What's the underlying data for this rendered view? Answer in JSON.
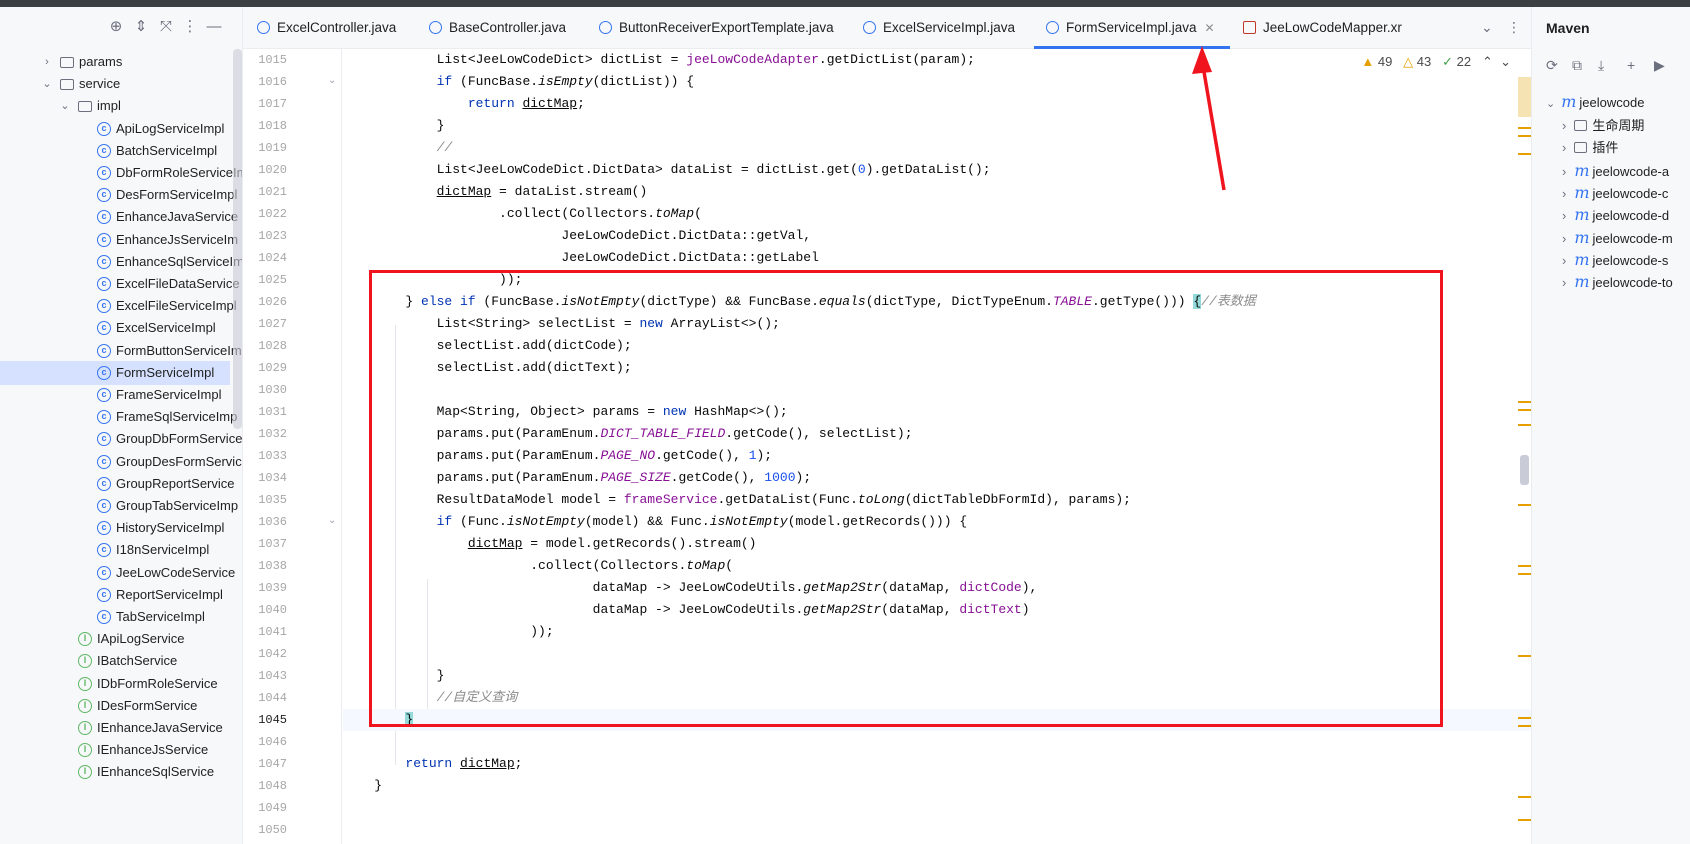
{
  "project_tree": {
    "toolbar_icons": [
      "crosshair-icon",
      "expand-icon",
      "collapse-icon",
      "more-icon",
      "minimize-icon"
    ],
    "items": [
      {
        "label": "params",
        "kind": "folder",
        "depth": 1,
        "arrow": "›"
      },
      {
        "label": "service",
        "kind": "folder",
        "depth": 1,
        "arrow": "⌄"
      },
      {
        "label": "impl",
        "kind": "folder",
        "depth": 2,
        "arrow": "⌄"
      },
      {
        "label": "ApiLogServiceImpl",
        "kind": "class",
        "depth": 3
      },
      {
        "label": "BatchServiceImpl",
        "kind": "class",
        "depth": 3
      },
      {
        "label": "DbFormRoleServiceIm",
        "kind": "class",
        "depth": 3
      },
      {
        "label": "DesFormServiceImpl",
        "kind": "class",
        "depth": 3
      },
      {
        "label": "EnhanceJavaService",
        "kind": "class",
        "depth": 3
      },
      {
        "label": "EnhanceJsServiceIm",
        "kind": "class",
        "depth": 3
      },
      {
        "label": "EnhanceSqlServiceIm",
        "kind": "class",
        "depth": 3
      },
      {
        "label": "ExcelFileDataService",
        "kind": "class",
        "depth": 3
      },
      {
        "label": "ExcelFileServiceImpl",
        "kind": "class",
        "depth": 3
      },
      {
        "label": "ExcelServiceImpl",
        "kind": "class",
        "depth": 3
      },
      {
        "label": "FormButtonServiceIm",
        "kind": "class",
        "depth": 3
      },
      {
        "label": "FormServiceImpl",
        "kind": "class",
        "depth": 3,
        "selected": true
      },
      {
        "label": "FrameServiceImpl",
        "kind": "class",
        "depth": 3
      },
      {
        "label": "FrameSqlServiceImp",
        "kind": "class",
        "depth": 3
      },
      {
        "label": "GroupDbFormService",
        "kind": "class",
        "depth": 3
      },
      {
        "label": "GroupDesFormServic",
        "kind": "class",
        "depth": 3
      },
      {
        "label": "GroupReportService",
        "kind": "class",
        "depth": 3
      },
      {
        "label": "GroupTabServiceImp",
        "kind": "class",
        "depth": 3
      },
      {
        "label": "HistoryServiceImpl",
        "kind": "class",
        "depth": 3
      },
      {
        "label": "I18nServiceImpl",
        "kind": "class",
        "depth": 3
      },
      {
        "label": "JeeLowCodeService",
        "kind": "class",
        "depth": 3
      },
      {
        "label": "ReportServiceImpl",
        "kind": "class",
        "depth": 3
      },
      {
        "label": "TabServiceImpl",
        "kind": "class",
        "depth": 3
      },
      {
        "label": "IApiLogService",
        "kind": "interface",
        "depth": 2
      },
      {
        "label": "IBatchService",
        "kind": "interface",
        "depth": 2
      },
      {
        "label": "IDbFormRoleService",
        "kind": "interface",
        "depth": 2
      },
      {
        "label": "IDesFormService",
        "kind": "interface",
        "depth": 2
      },
      {
        "label": "IEnhanceJavaService",
        "kind": "interface",
        "depth": 2
      },
      {
        "label": "IEnhanceJsService",
        "kind": "interface",
        "depth": 2
      },
      {
        "label": "IEnhanceSqlService",
        "kind": "interface",
        "depth": 2
      }
    ]
  },
  "tabs": [
    {
      "label": "ExcelController.java",
      "active": false
    },
    {
      "label": "BaseController.java",
      "active": false
    },
    {
      "label": "ButtonReceiverExportTemplate.java",
      "active": false
    },
    {
      "label": "ExcelServiceImpl.java",
      "active": false
    },
    {
      "label": "FormServiceImpl.java",
      "active": true
    },
    {
      "label": "JeeLowCodeMapper.xr",
      "active": false
    }
  ],
  "inspections": {
    "warnings": "49",
    "weak_warnings": "43",
    "ok": "22"
  },
  "editor": {
    "first_line": 1015,
    "current_line": 1045,
    "fold_lines": [
      1016,
      1036
    ]
  },
  "maven": {
    "title": "Maven",
    "root": "jeelowcode",
    "children": [
      {
        "label": "生命周期",
        "kind": "folder"
      },
      {
        "label": "插件",
        "kind": "folder"
      },
      {
        "label": "jeelowcode-a",
        "kind": "module"
      },
      {
        "label": "jeelowcode-c",
        "kind": "module"
      },
      {
        "label": "jeelowcode-d",
        "kind": "module"
      },
      {
        "label": "jeelowcode-m",
        "kind": "module"
      },
      {
        "label": "jeelowcode-s",
        "kind": "module"
      },
      {
        "label": "jeelowcode-to",
        "kind": "module"
      }
    ]
  }
}
